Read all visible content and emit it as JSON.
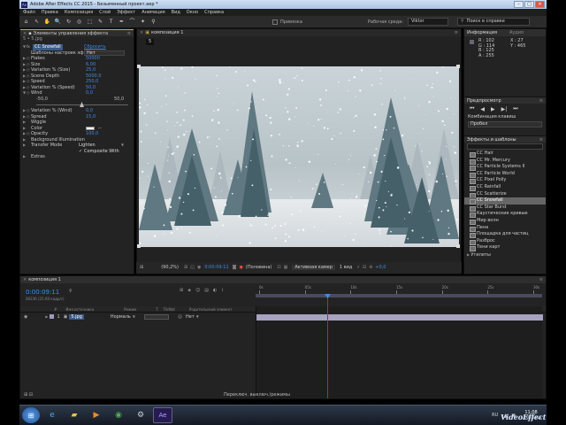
{
  "window": {
    "title": "Adobe After Effects CC 2015 - Безымянный проект.aep *",
    "controls": [
      "–",
      "□",
      "✕"
    ]
  },
  "menu": [
    "Файл",
    "Правка",
    "Композиция",
    "Слой",
    "Эффект",
    "Анимация",
    "Вид",
    "Окно",
    "Справка"
  ],
  "toolbar": {
    "tools": [
      "⌂",
      "↖",
      "✋",
      "🔍",
      "↻",
      "◎",
      "⬚",
      "✎",
      "T",
      "✒",
      "⌒",
      "✦",
      "⚲"
    ],
    "snap_label": "Привязка",
    "workspace_label": "Рабочая среда:",
    "workspace_value": "Viktor",
    "search_placeholder": "Поиск в справке"
  },
  "effect_panel": {
    "tab_title": "Элементы управления эффекта",
    "layer_name": "5.jpg",
    "header_path": "5 • 5.jpg",
    "effect_name": "CC Snowfall",
    "reset_label": "Сбросить",
    "presets_label": "Шаблоны настроек эф",
    "presets_value": "Нет",
    "params": [
      {
        "name": "Flakes",
        "value": "50000",
        "kind": "sw"
      },
      {
        "name": "Size",
        "value": "6,00",
        "kind": "sw"
      },
      {
        "name": "Variation % (Size)",
        "value": "25,0",
        "kind": "sw"
      },
      {
        "name": "Scene Depth",
        "value": "5000,0",
        "kind": "sw"
      },
      {
        "name": "Speed",
        "value": "250,0",
        "kind": "sw"
      },
      {
        "name": "Variation % (Speed)",
        "value": "50,0",
        "kind": "sw"
      },
      {
        "name": "Wind",
        "value": "0,0",
        "kind": "open"
      }
    ],
    "wind_range": {
      "min": "-50,0",
      "max": "50,0"
    },
    "params2": [
      {
        "name": "Variation % (Wind)",
        "value": "0,0",
        "kind": "sw"
      },
      {
        "name": "Spread",
        "value": "15,0",
        "kind": "sw"
      },
      {
        "name": "Wiggle",
        "value": "",
        "kind": "tri"
      },
      {
        "name": "Color",
        "value": "",
        "kind": "color"
      },
      {
        "name": "Opacity",
        "value": "100,0",
        "kind": "sw"
      },
      {
        "name": "Background Illumination",
        "value": "",
        "kind": "tri"
      },
      {
        "name": "Transfer Mode",
        "value": "Lighten",
        "kind": "select"
      },
      {
        "name": "",
        "value": "Composite With",
        "kind": "check"
      },
      {
        "name": "Extras",
        "value": "",
        "kind": "tri"
      }
    ]
  },
  "comp_panel": {
    "tab_title": "композиция 1",
    "comp_chip": "5",
    "footer": {
      "zoom": "(90,2%)",
      "timecode": "0:00:09:11",
      "resolution": "(Половина)",
      "camera": "Активная камер",
      "views": "1 вид",
      "exposure": "+0,0"
    }
  },
  "info_panel": {
    "tab_title": "Информация",
    "audio_tab": "Аудио",
    "r": "R : 102",
    "g": "G : 114",
    "b": "B : 125",
    "a": "A : 255",
    "x": "X : 27",
    "y": "Y : 465"
  },
  "preview_panel": {
    "tab_title": "Предпросмотр",
    "shortcut_label": "Комбинация клавиш",
    "shortcut_value": "Пробел"
  },
  "fx_panel": {
    "tab_title": "Эффекты и шаблоны",
    "search_placeholder": "",
    "items": [
      "CC Hair",
      "CC Mr. Mercury",
      "CC Particle Systems II",
      "CC Particle World",
      "CC Pixel Polly",
      "CC Rainfall",
      "CC Scatterize",
      "CC Snowfall",
      "CC Star Burst",
      "Каустические кривые",
      "Мир волн",
      "Пена",
      "Площадка для частиц",
      "Разброс",
      "Тени карт"
    ],
    "selected_index": 7,
    "footer": "Утилиты"
  },
  "timeline": {
    "tab_title": "композиция 1",
    "timecode": "0:00:09:11",
    "frame_info": "00236 (25.00 кадр/с)",
    "columns": [
      "#",
      "Имя источника",
      "Режим",
      "T",
      "TrkMat",
      "Родительский элемент"
    ],
    "layer": {
      "index": "1",
      "name": "5.jpg",
      "mode": "Нормаль",
      "parent": "Нет"
    },
    "ruler": [
      "0s",
      "05s",
      "10s",
      "15s",
      "20s",
      "25s",
      "30s"
    ],
    "footer": "Переключ. выключ./режимы",
    "playhead_fraction": 0.25
  },
  "taskbar": {
    "apps": [
      "win",
      "ie",
      "folder",
      "media",
      "chrome",
      "steam",
      "ae"
    ],
    "lang": "RU",
    "time": "11:08",
    "date": "13.08.2015",
    "watermark": "VideoEffect"
  },
  "colors": {
    "accent_blue": "#3f8de3",
    "playhead_red": "#d21f1f",
    "layer_bar": "#a7a2bf"
  }
}
